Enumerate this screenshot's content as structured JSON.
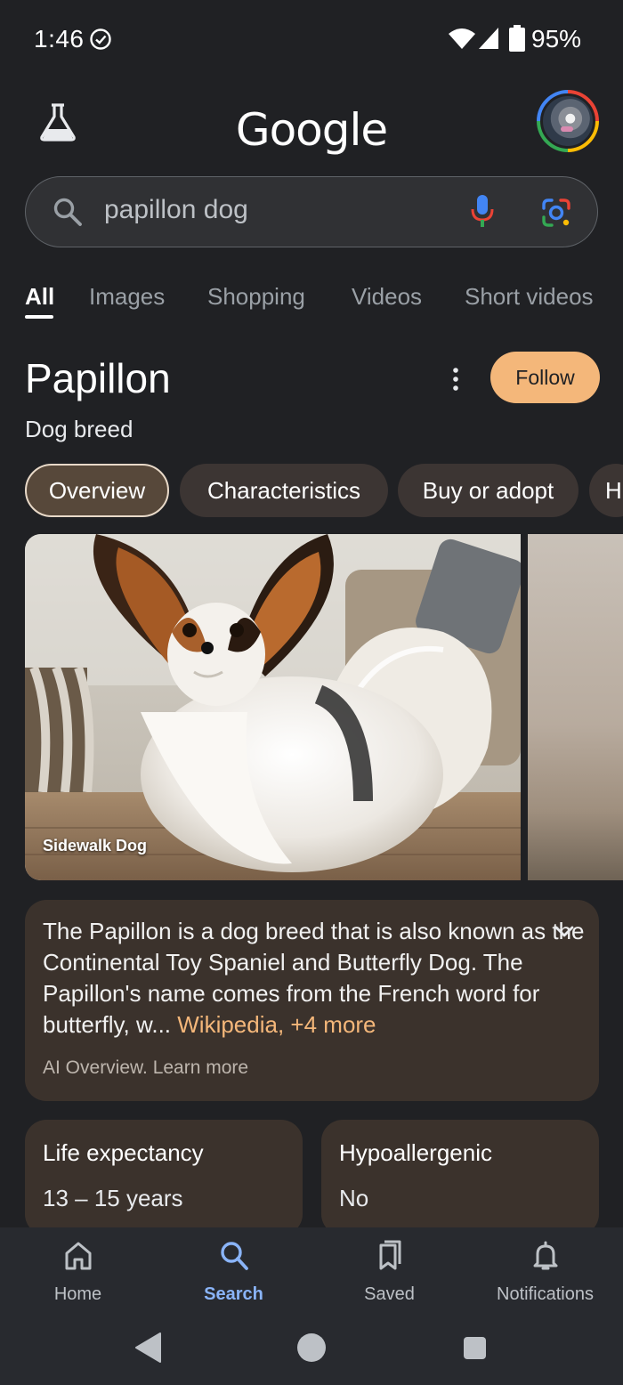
{
  "status_bar": {
    "time": "1:46",
    "battery": "95%"
  },
  "header": {
    "logo": "Google"
  },
  "search": {
    "query": "papillon dog"
  },
  "tabs": [
    {
      "label": "All",
      "active": true
    },
    {
      "label": "Images"
    },
    {
      "label": "Shopping"
    },
    {
      "label": "Videos"
    },
    {
      "label": "Short videos"
    }
  ],
  "entity": {
    "title": "Papillon",
    "subtitle": "Dog breed",
    "follow_label": "Follow"
  },
  "chips": [
    {
      "label": "Overview",
      "active": true
    },
    {
      "label": "Characteristics"
    },
    {
      "label": "Buy or adopt"
    },
    {
      "label": "H"
    }
  ],
  "images": [
    {
      "caption": "Sidewalk Dog"
    }
  ],
  "ai_overview": {
    "text": "The Papillon is a dog breed that is also known as the Continental Toy Spaniel and Butterfly Dog. The Papillon's name comes from the French word for butterfly, w...",
    "source": "Wikipedia",
    "more": ", +4 more",
    "footer": "AI Overview. Learn more"
  },
  "facts": [
    {
      "label": "Life expectancy",
      "value": "13 – 15 years"
    },
    {
      "label": "Hypoallergenic",
      "value": "No"
    }
  ],
  "bottom_nav": [
    {
      "label": "Home",
      "icon": "home-icon"
    },
    {
      "label": "Search",
      "icon": "search-icon",
      "active": true
    },
    {
      "label": "Saved",
      "icon": "bookmark-icon"
    },
    {
      "label": "Notifications",
      "icon": "bell-icon"
    }
  ],
  "colors": {
    "background": "#202124",
    "accent_orange": "#f4b77a",
    "active_blue": "#8ab4f8",
    "card_brown": "#3b322c"
  }
}
